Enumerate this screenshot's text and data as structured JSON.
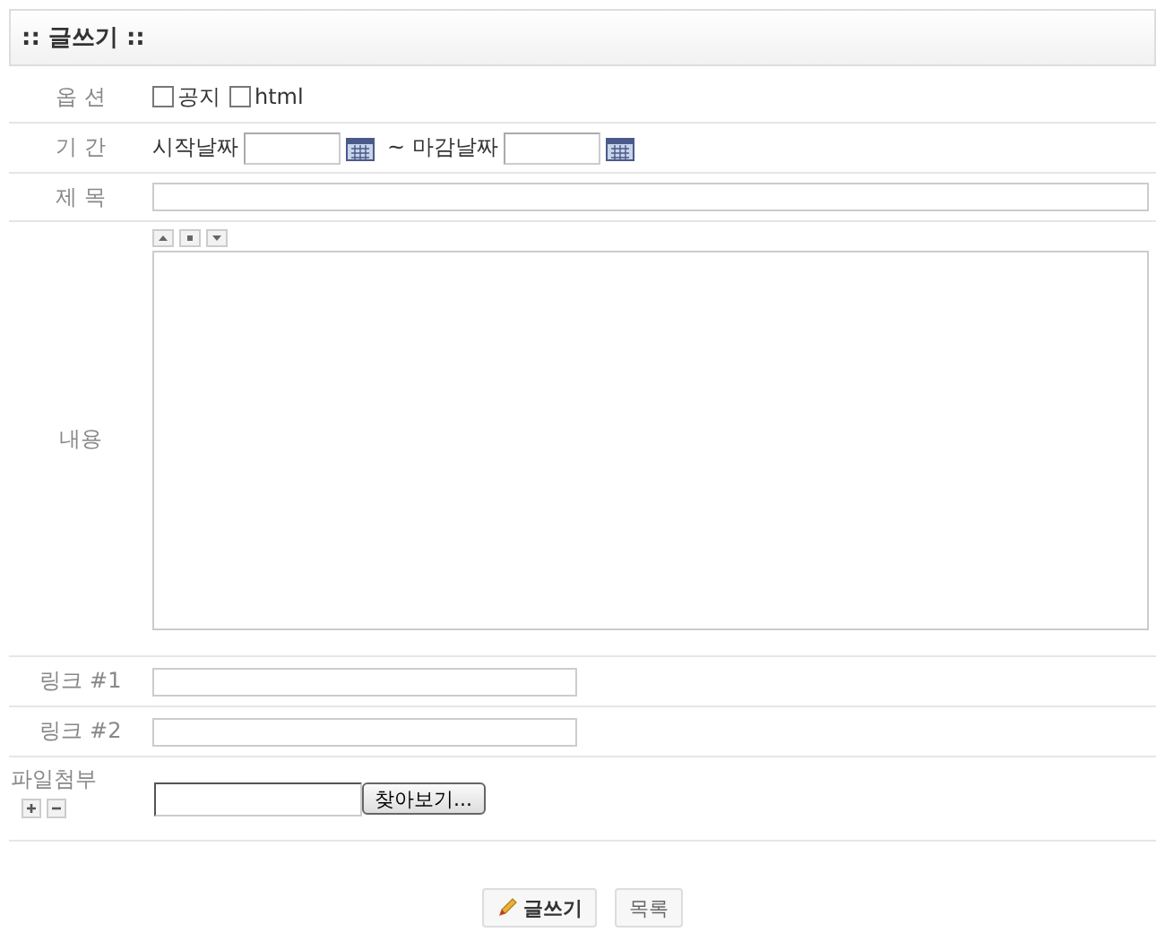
{
  "header": {
    "title": ":: 글쓰기 ::"
  },
  "options": {
    "label": "옵 션",
    "checkboxes": [
      {
        "label": "공지",
        "checked": false
      },
      {
        "label": "html",
        "checked": false
      }
    ]
  },
  "period": {
    "label": "기 간",
    "start_label": "시작날짜",
    "separator": "~ 마감날짜"
  },
  "subject": {
    "label": "제 목"
  },
  "content": {
    "label": "내용"
  },
  "links": [
    {
      "label": "링크 #1"
    },
    {
      "label": "링크 #2"
    }
  ],
  "attachment": {
    "label": "파일첨부",
    "browse_button": "찾아보기..."
  },
  "buttons": [
    {
      "label": "글쓰기",
      "kind": "primary"
    },
    {
      "label": "목록",
      "kind": "plain"
    }
  ]
}
